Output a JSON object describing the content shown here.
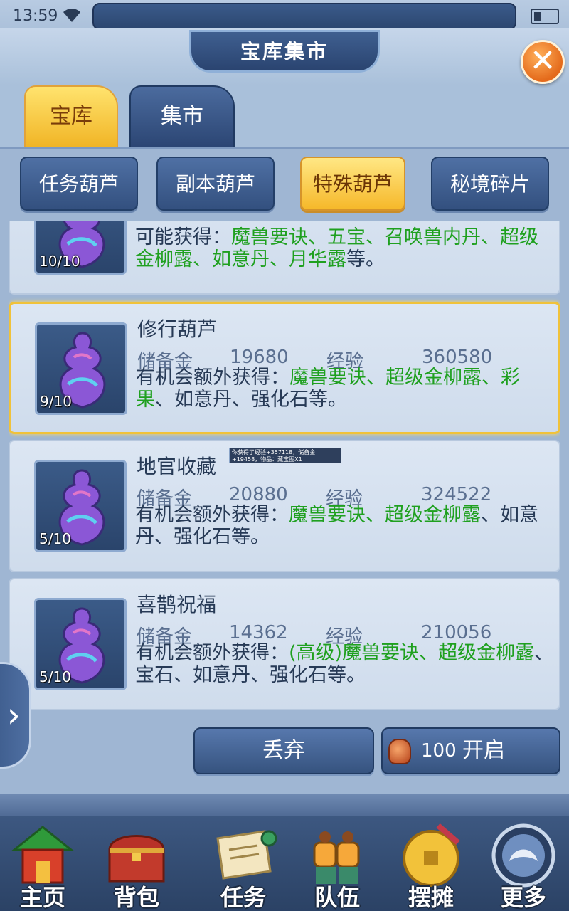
{
  "status": {
    "time": "13:59"
  },
  "window": {
    "title": "宝库集市"
  },
  "tabs": [
    {
      "label": "宝库",
      "active": true
    },
    {
      "label": "集市",
      "active": false
    }
  ],
  "subtabs": [
    {
      "label": "任务葫芦",
      "active": false
    },
    {
      "label": "副本葫芦",
      "active": false
    },
    {
      "label": "特殊葫芦",
      "active": true
    },
    {
      "label": "秘境碎片",
      "active": false
    }
  ],
  "items": [
    {
      "name": "",
      "count": "10/10",
      "desc_prefix": "可能获得：",
      "desc_green": "魔兽要诀、五宝、召唤兽内丹、超级金柳露、如意丹、月华露",
      "desc_suffix": "等。"
    },
    {
      "name": "修行葫芦",
      "count": "9/10",
      "reserve_label": "储备金",
      "reserve": "19680",
      "exp_label": "经验",
      "exp": "360580",
      "desc_prefix": "有机会额外获得：",
      "desc_green": "魔兽要诀、超级金柳露、彩果",
      "desc_suffix": "、如意丹、强化石等。",
      "selected": true
    },
    {
      "name": "地官收藏",
      "count": "5/10",
      "reserve_label": "储备金",
      "reserve": "20880",
      "exp_label": "经验",
      "exp": "324522",
      "desc_prefix": "有机会额外获得：",
      "desc_green": "魔兽要诀、超级金柳露",
      "desc_suffix": "、如意丹、强化石等。"
    },
    {
      "name": "喜鹊祝福",
      "count": "5/10",
      "reserve_label": "储备金",
      "reserve": "14362",
      "exp_label": "经验",
      "exp": "210056",
      "desc_prefix": "有机会额外获得：",
      "desc_green": "(高级)魔兽要诀、超级金柳露",
      "desc_suffix": "、宝石、如意丹、强化石等。"
    }
  ],
  "tooltip": "你获得了经验+357118，储备金+19458，物品：藏宝图X1",
  "actions": {
    "discard": "丢弃",
    "open_cost": "100",
    "open_label": "开启"
  },
  "nav": [
    {
      "label": "主页",
      "icon": "pavilion-icon"
    },
    {
      "label": "背包",
      "icon": "treasure-chest-icon"
    },
    {
      "label": "任务",
      "icon": "scroll-icon"
    },
    {
      "label": "队伍",
      "icon": "team-icon"
    },
    {
      "label": "摆摊",
      "icon": "coin-icon"
    },
    {
      "label": "更多",
      "icon": "more-icon"
    }
  ],
  "colors": {
    "accent_gold": "#f1b526",
    "panel_blue": "#2c4674",
    "highlight_green": "#1fa01f"
  }
}
